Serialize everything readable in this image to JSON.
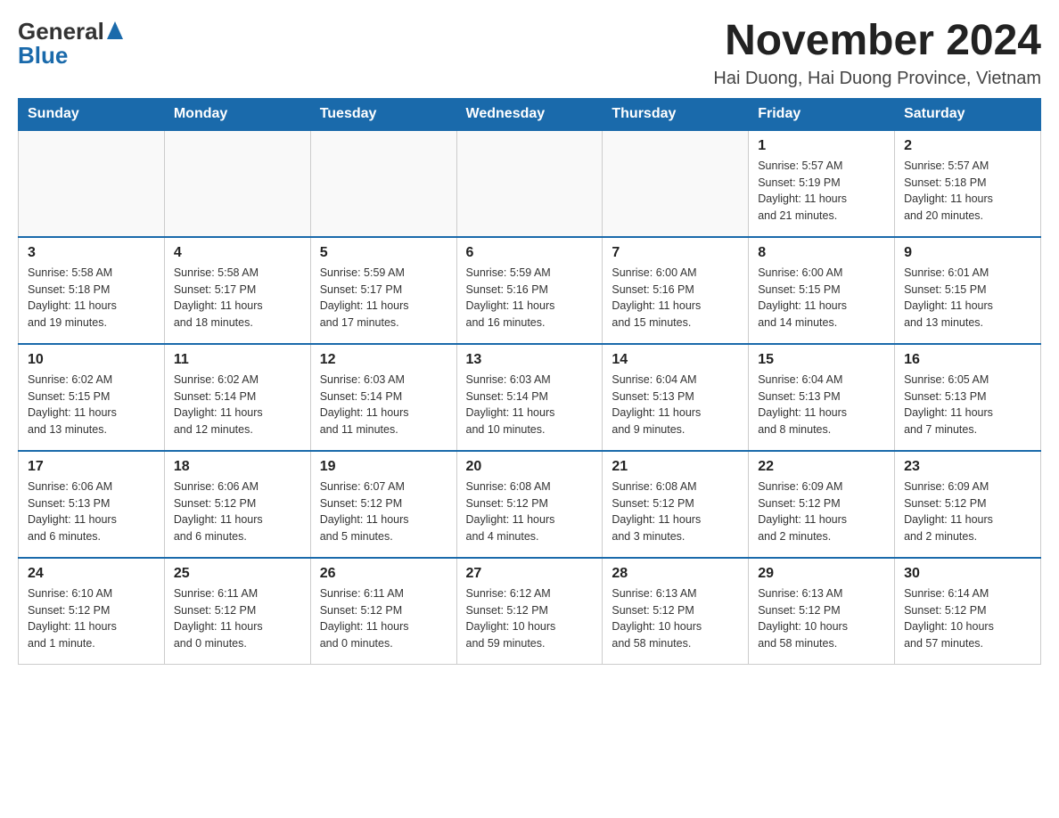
{
  "header": {
    "logo_text_general": "General",
    "logo_text_blue": "Blue",
    "month_title": "November 2024",
    "location": "Hai Duong, Hai Duong Province, Vietnam"
  },
  "days_of_week": [
    "Sunday",
    "Monday",
    "Tuesday",
    "Wednesday",
    "Thursday",
    "Friday",
    "Saturday"
  ],
  "weeks": [
    [
      {
        "day": "",
        "info": ""
      },
      {
        "day": "",
        "info": ""
      },
      {
        "day": "",
        "info": ""
      },
      {
        "day": "",
        "info": ""
      },
      {
        "day": "",
        "info": ""
      },
      {
        "day": "1",
        "info": "Sunrise: 5:57 AM\nSunset: 5:19 PM\nDaylight: 11 hours\nand 21 minutes."
      },
      {
        "day": "2",
        "info": "Sunrise: 5:57 AM\nSunset: 5:18 PM\nDaylight: 11 hours\nand 20 minutes."
      }
    ],
    [
      {
        "day": "3",
        "info": "Sunrise: 5:58 AM\nSunset: 5:18 PM\nDaylight: 11 hours\nand 19 minutes."
      },
      {
        "day": "4",
        "info": "Sunrise: 5:58 AM\nSunset: 5:17 PM\nDaylight: 11 hours\nand 18 minutes."
      },
      {
        "day": "5",
        "info": "Sunrise: 5:59 AM\nSunset: 5:17 PM\nDaylight: 11 hours\nand 17 minutes."
      },
      {
        "day": "6",
        "info": "Sunrise: 5:59 AM\nSunset: 5:16 PM\nDaylight: 11 hours\nand 16 minutes."
      },
      {
        "day": "7",
        "info": "Sunrise: 6:00 AM\nSunset: 5:16 PM\nDaylight: 11 hours\nand 15 minutes."
      },
      {
        "day": "8",
        "info": "Sunrise: 6:00 AM\nSunset: 5:15 PM\nDaylight: 11 hours\nand 14 minutes."
      },
      {
        "day": "9",
        "info": "Sunrise: 6:01 AM\nSunset: 5:15 PM\nDaylight: 11 hours\nand 13 minutes."
      }
    ],
    [
      {
        "day": "10",
        "info": "Sunrise: 6:02 AM\nSunset: 5:15 PM\nDaylight: 11 hours\nand 13 minutes."
      },
      {
        "day": "11",
        "info": "Sunrise: 6:02 AM\nSunset: 5:14 PM\nDaylight: 11 hours\nand 12 minutes."
      },
      {
        "day": "12",
        "info": "Sunrise: 6:03 AM\nSunset: 5:14 PM\nDaylight: 11 hours\nand 11 minutes."
      },
      {
        "day": "13",
        "info": "Sunrise: 6:03 AM\nSunset: 5:14 PM\nDaylight: 11 hours\nand 10 minutes."
      },
      {
        "day": "14",
        "info": "Sunrise: 6:04 AM\nSunset: 5:13 PM\nDaylight: 11 hours\nand 9 minutes."
      },
      {
        "day": "15",
        "info": "Sunrise: 6:04 AM\nSunset: 5:13 PM\nDaylight: 11 hours\nand 8 minutes."
      },
      {
        "day": "16",
        "info": "Sunrise: 6:05 AM\nSunset: 5:13 PM\nDaylight: 11 hours\nand 7 minutes."
      }
    ],
    [
      {
        "day": "17",
        "info": "Sunrise: 6:06 AM\nSunset: 5:13 PM\nDaylight: 11 hours\nand 6 minutes."
      },
      {
        "day": "18",
        "info": "Sunrise: 6:06 AM\nSunset: 5:12 PM\nDaylight: 11 hours\nand 6 minutes."
      },
      {
        "day": "19",
        "info": "Sunrise: 6:07 AM\nSunset: 5:12 PM\nDaylight: 11 hours\nand 5 minutes."
      },
      {
        "day": "20",
        "info": "Sunrise: 6:08 AM\nSunset: 5:12 PM\nDaylight: 11 hours\nand 4 minutes."
      },
      {
        "day": "21",
        "info": "Sunrise: 6:08 AM\nSunset: 5:12 PM\nDaylight: 11 hours\nand 3 minutes."
      },
      {
        "day": "22",
        "info": "Sunrise: 6:09 AM\nSunset: 5:12 PM\nDaylight: 11 hours\nand 2 minutes."
      },
      {
        "day": "23",
        "info": "Sunrise: 6:09 AM\nSunset: 5:12 PM\nDaylight: 11 hours\nand 2 minutes."
      }
    ],
    [
      {
        "day": "24",
        "info": "Sunrise: 6:10 AM\nSunset: 5:12 PM\nDaylight: 11 hours\nand 1 minute."
      },
      {
        "day": "25",
        "info": "Sunrise: 6:11 AM\nSunset: 5:12 PM\nDaylight: 11 hours\nand 0 minutes."
      },
      {
        "day": "26",
        "info": "Sunrise: 6:11 AM\nSunset: 5:12 PM\nDaylight: 11 hours\nand 0 minutes."
      },
      {
        "day": "27",
        "info": "Sunrise: 6:12 AM\nSunset: 5:12 PM\nDaylight: 10 hours\nand 59 minutes."
      },
      {
        "day": "28",
        "info": "Sunrise: 6:13 AM\nSunset: 5:12 PM\nDaylight: 10 hours\nand 58 minutes."
      },
      {
        "day": "29",
        "info": "Sunrise: 6:13 AM\nSunset: 5:12 PM\nDaylight: 10 hours\nand 58 minutes."
      },
      {
        "day": "30",
        "info": "Sunrise: 6:14 AM\nSunset: 5:12 PM\nDaylight: 10 hours\nand 57 minutes."
      }
    ]
  ]
}
